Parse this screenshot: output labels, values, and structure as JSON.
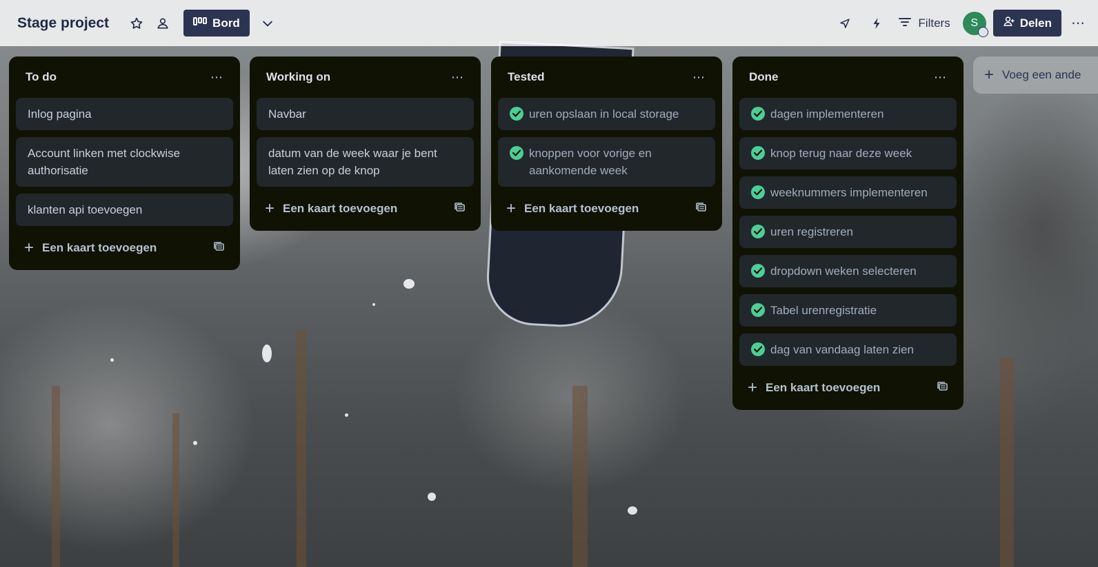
{
  "board": {
    "title": "Stage project",
    "view_label": "Bord",
    "filters_label": "Filters",
    "avatar_initial": "S",
    "share_label": "Delen",
    "add_list_label": "Voeg een ande"
  },
  "colors": {
    "list_bg": "#101204",
    "card_bg": "#22272b",
    "check_green": "#4bce97",
    "button_navy": "#2b3450"
  },
  "lists": [
    {
      "title": "To do",
      "cards": [
        {
          "text": "Inlog pagina",
          "done": false
        },
        {
          "text": "Account linken met clockwise authorisatie",
          "done": false
        },
        {
          "text": "klanten api toevoegen",
          "done": false
        }
      ],
      "add_label": "Een kaart toevoegen"
    },
    {
      "title": "Working on",
      "cards": [
        {
          "text": "Navbar",
          "done": false
        },
        {
          "text": "datum van de week waar je bent laten zien op de knop",
          "done": false
        }
      ],
      "add_label": "Een kaart toevoegen"
    },
    {
      "title": "Tested",
      "cards": [
        {
          "text": "uren opslaan in local storage",
          "done": true
        },
        {
          "text": "knoppen voor vorige en aankomende week",
          "done": true
        }
      ],
      "add_label": "Een kaart toevoegen"
    },
    {
      "title": "Done",
      "cards": [
        {
          "text": "dagen implementeren",
          "done": true
        },
        {
          "text": "knop terug naar deze week",
          "done": true
        },
        {
          "text": "weeknummers implementeren",
          "done": true
        },
        {
          "text": "uren registreren",
          "done": true
        },
        {
          "text": "dropdown weken selecteren",
          "done": true
        },
        {
          "text": "Tabel urenregistratie",
          "done": true
        },
        {
          "text": "dag van vandaag laten zien",
          "done": true
        }
      ],
      "add_label": "Een kaart toevoegen"
    }
  ]
}
